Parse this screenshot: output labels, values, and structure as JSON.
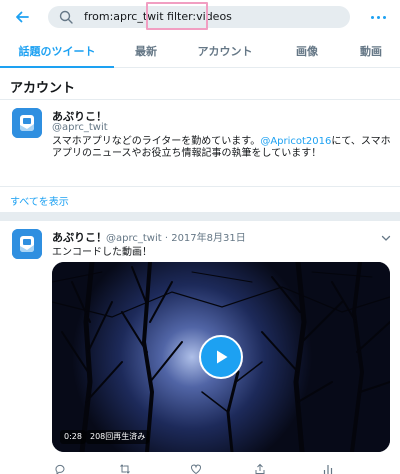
{
  "search": {
    "query": "from:aprc_twit filter:videos"
  },
  "tabs": [
    {
      "label": "話題のツイート",
      "active": true
    },
    {
      "label": "最新",
      "active": false
    },
    {
      "label": "アカウント",
      "active": false
    },
    {
      "label": "画像",
      "active": false
    },
    {
      "label": "動画",
      "active": false
    }
  ],
  "accounts_section": {
    "title": "アカウント",
    "account": {
      "name": "あぷりこ！",
      "handle": "@aprc_twit",
      "bio_line1": "スマホアプリなどのライターを勤めています。",
      "bio_mention": "@Apricot2016",
      "bio_line2": "にて、スマホアプリのニュースやお役立ち情報記事の執筆をしています！"
    },
    "show_all": "すべてを表示"
  },
  "tweet": {
    "name": "あぷりこ！",
    "handle": "@aprc_twit",
    "date": "2017年8月31日",
    "meta": "@aprc_twit · 2017年8月31日",
    "text": "エンコードした動画！",
    "video": {
      "duration": "0:28",
      "views": "208回再生済み"
    }
  },
  "icons": {
    "back": "back-arrow-icon",
    "search": "search-icon",
    "more": "more-icon",
    "chevron": "chevron-down-icon",
    "reply": "reply-icon",
    "retweet": "retweet-icon",
    "like": "like-icon",
    "share": "share-icon",
    "analytics": "analytics-icon"
  },
  "colors": {
    "accent": "#1da1f2",
    "muted": "#657786",
    "border": "#e6ecf0",
    "highlight": "#f19ec2"
  }
}
